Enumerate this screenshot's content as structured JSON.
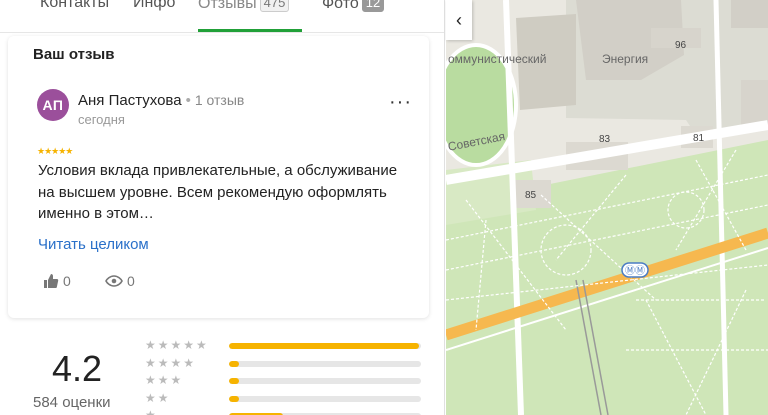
{
  "tabs": [
    {
      "label": "Контакты",
      "count": ""
    },
    {
      "label": "Инфо",
      "count": ""
    },
    {
      "label": "Отзывы",
      "count": "475"
    },
    {
      "label": "Фото",
      "count": "12"
    }
  ],
  "review": {
    "section_title": "Ваш отзыв",
    "avatar_initials": "АП",
    "author": "Аня Пастухова",
    "author_reviews": "1 отзыв",
    "date": "сегодня",
    "stars": "★★★★★",
    "text": "Условия вклада привлекательные, а обслуживание на высшем уровне. Всем рекомендую оформлять именно в этом…",
    "read_more": "Читать целиком",
    "likes": "0",
    "views": "0",
    "more_icon": "more-dots-icon"
  },
  "rating": {
    "value": "4.2",
    "count_label": "584 оценки",
    "distribution": [
      {
        "stars": "★★★★★",
        "fraction": 0.99
      },
      {
        "stars": "★★★★",
        "fraction": 0.05
      },
      {
        "stars": "★★★",
        "fraction": 0.05
      },
      {
        "stars": "★★",
        "fraction": 0.05
      },
      {
        "stars": "★",
        "fraction": 0.28
      }
    ]
  },
  "map": {
    "labels": {
      "street_soviet": "Советская",
      "kommunistichesky": "оммунистический",
      "energia": "Энергия"
    },
    "house_numbers": [
      "96",
      "83",
      "81",
      "85"
    ],
    "metro_icon": "metro-icon",
    "colors": {
      "road_main": "#f6b84f",
      "park": "#c9e2ae",
      "background": "#eae8e1"
    }
  },
  "colors": {
    "accent": "#21a038",
    "link": "#2a70c9",
    "star": "#f6b300",
    "avatar_bg": "#9b4f9b"
  }
}
